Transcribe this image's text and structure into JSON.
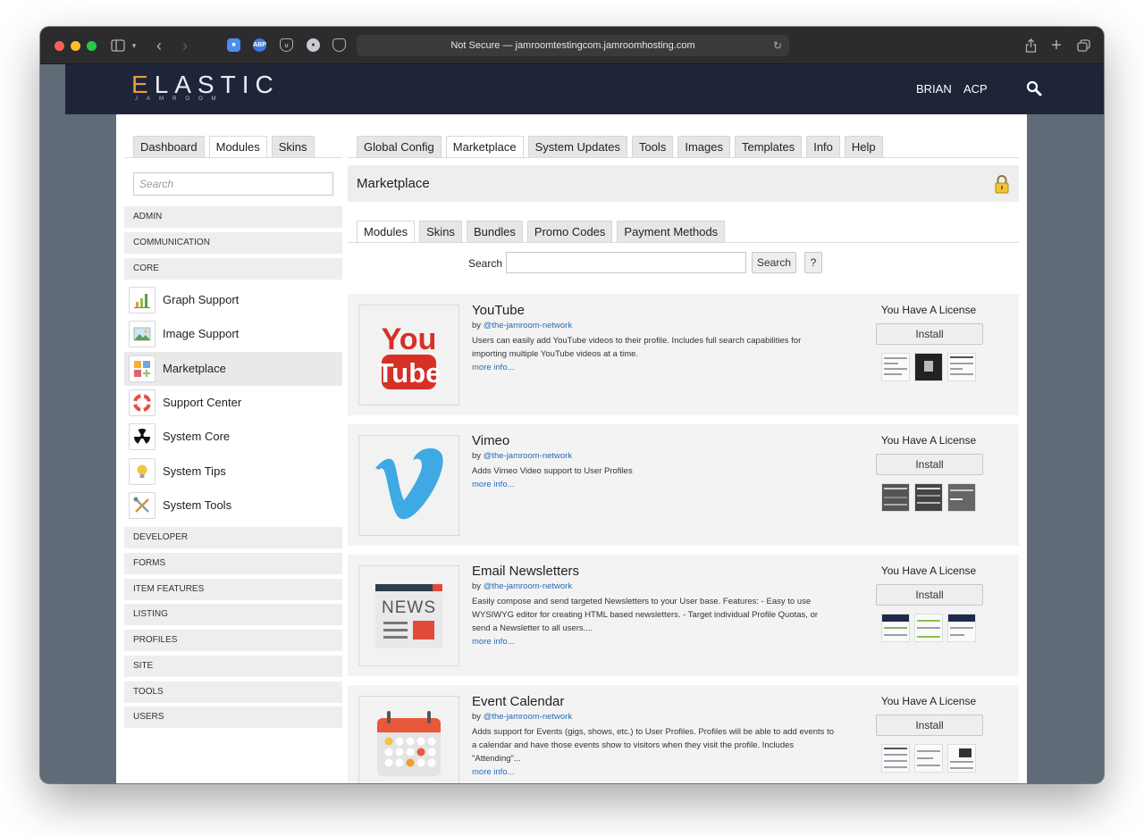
{
  "browser": {
    "address": "Not Secure — jamroomtestingcom.jamroomhosting.com"
  },
  "site": {
    "logo_main_e": "E",
    "logo_main_rest": "LASTIC",
    "logo_sub": "JAMROOM",
    "nav": {
      "user": "BRIAN",
      "acp": "ACP"
    },
    "colors": {
      "header_bg": "#1e2539",
      "logo_accent": "#e89b3c",
      "link": "#2a6ab5"
    }
  },
  "left_tabs": [
    "Dashboard",
    "Modules",
    "Skins"
  ],
  "left_active_tab": "Modules",
  "sidebar": {
    "search_placeholder": "Search",
    "categories_top": [
      "ADMIN",
      "COMMUNICATION",
      "CORE"
    ],
    "modules": [
      {
        "label": "Graph Support",
        "icon": "bar-chart-icon"
      },
      {
        "label": "Image Support",
        "icon": "image-icon"
      },
      {
        "label": "Marketplace",
        "icon": "marketplace-icon",
        "active": true
      },
      {
        "label": "Support Center",
        "icon": "lifebuoy-icon"
      },
      {
        "label": "System Core",
        "icon": "radiation-icon"
      },
      {
        "label": "System Tips",
        "icon": "lightbulb-icon"
      },
      {
        "label": "System Tools",
        "icon": "tools-icon"
      }
    ],
    "categories_bottom": [
      "DEVELOPER",
      "FORMS",
      "ITEM FEATURES",
      "LISTING",
      "PROFILES",
      "SITE",
      "TOOLS",
      "USERS"
    ]
  },
  "main_tabs": [
    "Global Config",
    "Marketplace",
    "System Updates",
    "Tools",
    "Images",
    "Templates",
    "Info",
    "Help"
  ],
  "main_active_tab": "Marketplace",
  "marketplace": {
    "title": "Marketplace",
    "sub_tabs": [
      "Modules",
      "Skins",
      "Bundles",
      "Promo Codes",
      "Payment Methods"
    ],
    "sub_active_tab": "Modules",
    "search_label": "Search",
    "search_button": "Search",
    "help_button": "?",
    "items": [
      {
        "title": "YouTube",
        "by_prefix": "by",
        "author": "@the-jamroom-network",
        "description": "Users can easily add YouTube videos to their profile. Includes full search capabilities for importing multiple YouTube videos at a time.",
        "more": "more info...",
        "license": "You Have A License",
        "install": "Install",
        "thumb_icon": "youtube-logo-icon"
      },
      {
        "title": "Vimeo",
        "by_prefix": "by",
        "author": "@the-jamroom-network",
        "description": "Adds Vimeo Video support to User Profiles",
        "more": "more info...",
        "license": "You Have A License",
        "install": "Install",
        "thumb_icon": "vimeo-logo-icon"
      },
      {
        "title": "Email Newsletters",
        "by_prefix": "by",
        "author": "@the-jamroom-network",
        "description": "Easily compose and send targeted Newsletters to your User base. Features: - Easy to use WYSIWYG editor for creating HTML based newsletters. - Target individual Profile Quotas, or send a Newsletter to all users....",
        "more": "more info...",
        "license": "You Have A License",
        "install": "Install",
        "thumb_icon": "newspaper-icon"
      },
      {
        "title": "Event Calendar",
        "by_prefix": "by",
        "author": "@the-jamroom-network",
        "description": "Adds support for Events (gigs, shows, etc.) to User Profiles. Profiles will be able to add events to a calendar and have those events show to visitors when they visit the profile. Includes \"Attending\"...",
        "more": "more info...",
        "license": "You Have A License",
        "install": "Install",
        "thumb_icon": "calendar-icon"
      }
    ]
  }
}
